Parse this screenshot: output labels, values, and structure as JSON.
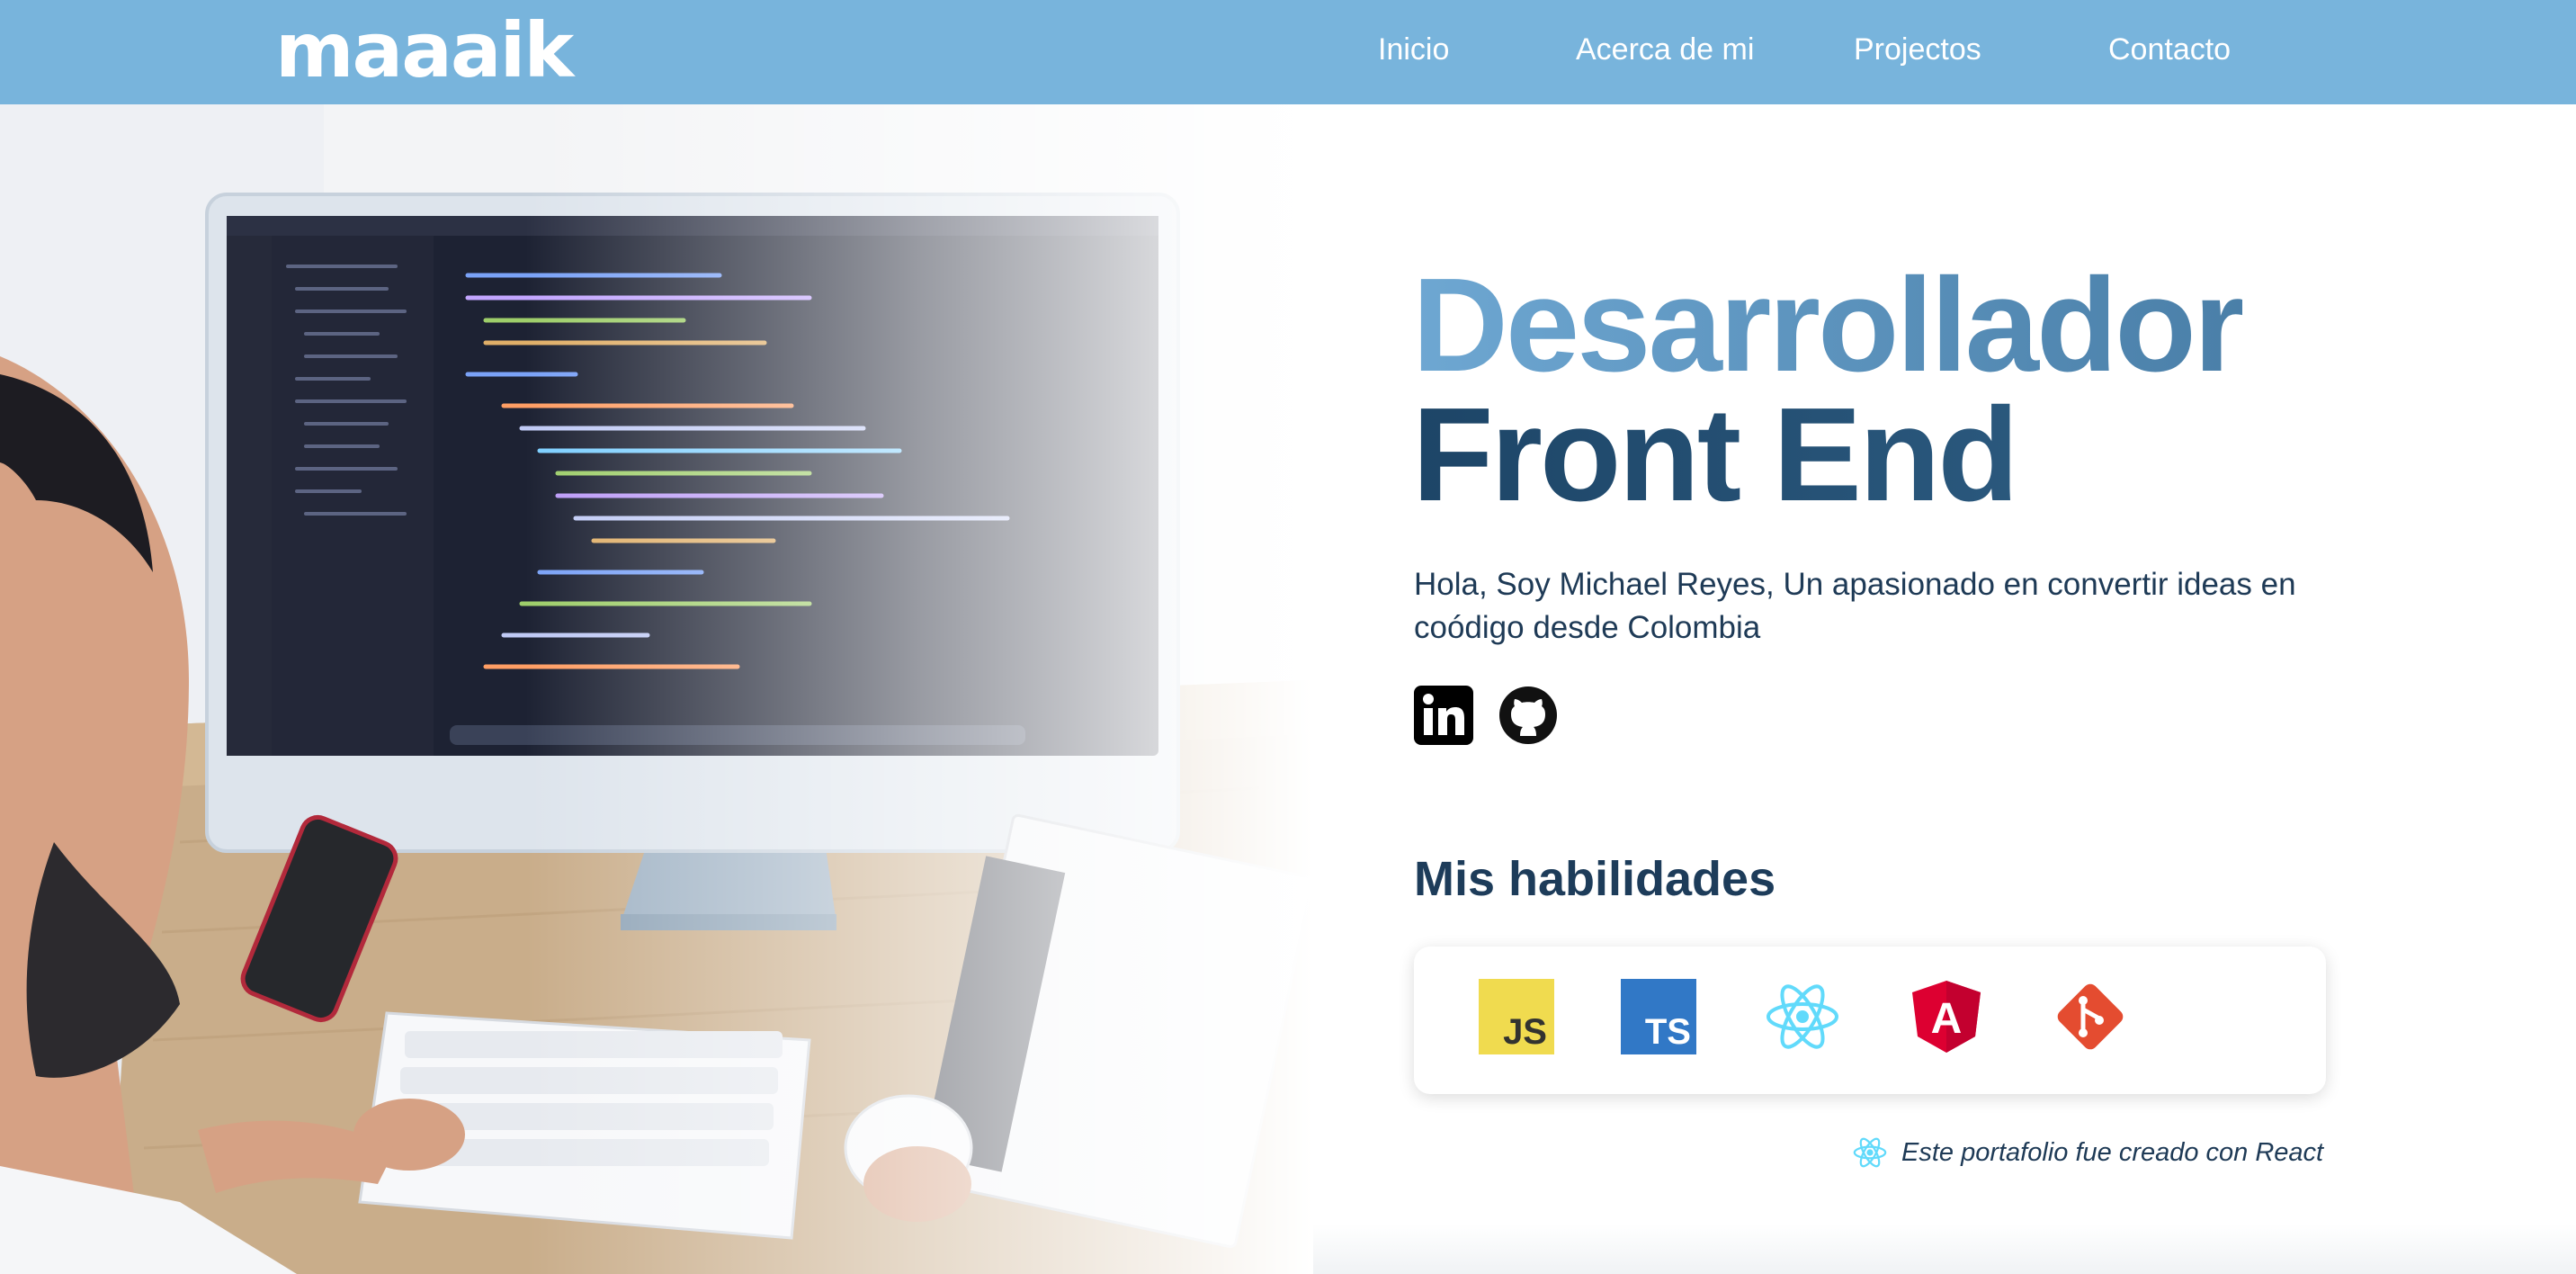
{
  "nav": {
    "logo": "maaaik",
    "links": [
      "Inicio",
      "Acerca de mi",
      "Projectos",
      "Contacto"
    ]
  },
  "hero": {
    "title_line1": "Desarrollador",
    "title_line2": "Front End",
    "intro": "Hola, Soy Michael Reyes, Un apasionado en convertir ideas en coódigo desde Colombia",
    "social": [
      {
        "icon": "linkedin-icon"
      },
      {
        "icon": "github-icon"
      }
    ]
  },
  "skills": {
    "title": "Mis habilidades",
    "items": [
      {
        "icon": "javascript-icon",
        "label": "JS",
        "color": "#f0db4f"
      },
      {
        "icon": "typescript-icon",
        "label": "TS",
        "color": "#3178c6"
      },
      {
        "icon": "react-icon",
        "color": "#61dafb"
      },
      {
        "icon": "angular-icon",
        "label": "A",
        "color": "#dd0031"
      },
      {
        "icon": "git-icon",
        "color": "#e44c30"
      }
    ]
  },
  "footer_note": {
    "icon": "react-icon",
    "text": "Este portafolio fue creado con React"
  },
  "colors": {
    "navbar": "#78b4dc",
    "title_light": "#6ea7d2",
    "title_dark": "#1d4567",
    "text": "#1e3a56"
  }
}
